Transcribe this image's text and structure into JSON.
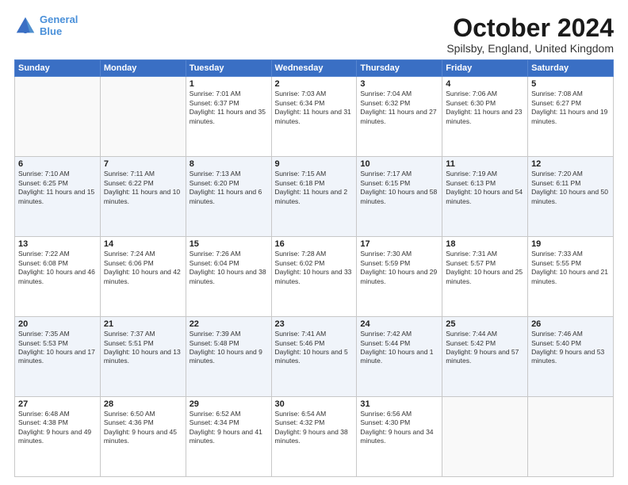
{
  "logo": {
    "line1": "General",
    "line2": "Blue"
  },
  "title": "October 2024",
  "subtitle": "Spilsby, England, United Kingdom",
  "days_of_week": [
    "Sunday",
    "Monday",
    "Tuesday",
    "Wednesday",
    "Thursday",
    "Friday",
    "Saturday"
  ],
  "weeks": [
    [
      {
        "day": "",
        "sunrise": "",
        "sunset": "",
        "daylight": ""
      },
      {
        "day": "",
        "sunrise": "",
        "sunset": "",
        "daylight": ""
      },
      {
        "day": "1",
        "sunrise": "Sunrise: 7:01 AM",
        "sunset": "Sunset: 6:37 PM",
        "daylight": "Daylight: 11 hours and 35 minutes."
      },
      {
        "day": "2",
        "sunrise": "Sunrise: 7:03 AM",
        "sunset": "Sunset: 6:34 PM",
        "daylight": "Daylight: 11 hours and 31 minutes."
      },
      {
        "day": "3",
        "sunrise": "Sunrise: 7:04 AM",
        "sunset": "Sunset: 6:32 PM",
        "daylight": "Daylight: 11 hours and 27 minutes."
      },
      {
        "day": "4",
        "sunrise": "Sunrise: 7:06 AM",
        "sunset": "Sunset: 6:30 PM",
        "daylight": "Daylight: 11 hours and 23 minutes."
      },
      {
        "day": "5",
        "sunrise": "Sunrise: 7:08 AM",
        "sunset": "Sunset: 6:27 PM",
        "daylight": "Daylight: 11 hours and 19 minutes."
      }
    ],
    [
      {
        "day": "6",
        "sunrise": "Sunrise: 7:10 AM",
        "sunset": "Sunset: 6:25 PM",
        "daylight": "Daylight: 11 hours and 15 minutes."
      },
      {
        "day": "7",
        "sunrise": "Sunrise: 7:11 AM",
        "sunset": "Sunset: 6:22 PM",
        "daylight": "Daylight: 11 hours and 10 minutes."
      },
      {
        "day": "8",
        "sunrise": "Sunrise: 7:13 AM",
        "sunset": "Sunset: 6:20 PM",
        "daylight": "Daylight: 11 hours and 6 minutes."
      },
      {
        "day": "9",
        "sunrise": "Sunrise: 7:15 AM",
        "sunset": "Sunset: 6:18 PM",
        "daylight": "Daylight: 11 hours and 2 minutes."
      },
      {
        "day": "10",
        "sunrise": "Sunrise: 7:17 AM",
        "sunset": "Sunset: 6:15 PM",
        "daylight": "Daylight: 10 hours and 58 minutes."
      },
      {
        "day": "11",
        "sunrise": "Sunrise: 7:19 AM",
        "sunset": "Sunset: 6:13 PM",
        "daylight": "Daylight: 10 hours and 54 minutes."
      },
      {
        "day": "12",
        "sunrise": "Sunrise: 7:20 AM",
        "sunset": "Sunset: 6:11 PM",
        "daylight": "Daylight: 10 hours and 50 minutes."
      }
    ],
    [
      {
        "day": "13",
        "sunrise": "Sunrise: 7:22 AM",
        "sunset": "Sunset: 6:08 PM",
        "daylight": "Daylight: 10 hours and 46 minutes."
      },
      {
        "day": "14",
        "sunrise": "Sunrise: 7:24 AM",
        "sunset": "Sunset: 6:06 PM",
        "daylight": "Daylight: 10 hours and 42 minutes."
      },
      {
        "day": "15",
        "sunrise": "Sunrise: 7:26 AM",
        "sunset": "Sunset: 6:04 PM",
        "daylight": "Daylight: 10 hours and 38 minutes."
      },
      {
        "day": "16",
        "sunrise": "Sunrise: 7:28 AM",
        "sunset": "Sunset: 6:02 PM",
        "daylight": "Daylight: 10 hours and 33 minutes."
      },
      {
        "day": "17",
        "sunrise": "Sunrise: 7:30 AM",
        "sunset": "Sunset: 5:59 PM",
        "daylight": "Daylight: 10 hours and 29 minutes."
      },
      {
        "day": "18",
        "sunrise": "Sunrise: 7:31 AM",
        "sunset": "Sunset: 5:57 PM",
        "daylight": "Daylight: 10 hours and 25 minutes."
      },
      {
        "day": "19",
        "sunrise": "Sunrise: 7:33 AM",
        "sunset": "Sunset: 5:55 PM",
        "daylight": "Daylight: 10 hours and 21 minutes."
      }
    ],
    [
      {
        "day": "20",
        "sunrise": "Sunrise: 7:35 AM",
        "sunset": "Sunset: 5:53 PM",
        "daylight": "Daylight: 10 hours and 17 minutes."
      },
      {
        "day": "21",
        "sunrise": "Sunrise: 7:37 AM",
        "sunset": "Sunset: 5:51 PM",
        "daylight": "Daylight: 10 hours and 13 minutes."
      },
      {
        "day": "22",
        "sunrise": "Sunrise: 7:39 AM",
        "sunset": "Sunset: 5:48 PM",
        "daylight": "Daylight: 10 hours and 9 minutes."
      },
      {
        "day": "23",
        "sunrise": "Sunrise: 7:41 AM",
        "sunset": "Sunset: 5:46 PM",
        "daylight": "Daylight: 10 hours and 5 minutes."
      },
      {
        "day": "24",
        "sunrise": "Sunrise: 7:42 AM",
        "sunset": "Sunset: 5:44 PM",
        "daylight": "Daylight: 10 hours and 1 minute."
      },
      {
        "day": "25",
        "sunrise": "Sunrise: 7:44 AM",
        "sunset": "Sunset: 5:42 PM",
        "daylight": "Daylight: 9 hours and 57 minutes."
      },
      {
        "day": "26",
        "sunrise": "Sunrise: 7:46 AM",
        "sunset": "Sunset: 5:40 PM",
        "daylight": "Daylight: 9 hours and 53 minutes."
      }
    ],
    [
      {
        "day": "27",
        "sunrise": "Sunrise: 6:48 AM",
        "sunset": "Sunset: 4:38 PM",
        "daylight": "Daylight: 9 hours and 49 minutes."
      },
      {
        "day": "28",
        "sunrise": "Sunrise: 6:50 AM",
        "sunset": "Sunset: 4:36 PM",
        "daylight": "Daylight: 9 hours and 45 minutes."
      },
      {
        "day": "29",
        "sunrise": "Sunrise: 6:52 AM",
        "sunset": "Sunset: 4:34 PM",
        "daylight": "Daylight: 9 hours and 41 minutes."
      },
      {
        "day": "30",
        "sunrise": "Sunrise: 6:54 AM",
        "sunset": "Sunset: 4:32 PM",
        "daylight": "Daylight: 9 hours and 38 minutes."
      },
      {
        "day": "31",
        "sunrise": "Sunrise: 6:56 AM",
        "sunset": "Sunset: 4:30 PM",
        "daylight": "Daylight: 9 hours and 34 minutes."
      },
      {
        "day": "",
        "sunrise": "",
        "sunset": "",
        "daylight": ""
      },
      {
        "day": "",
        "sunrise": "",
        "sunset": "",
        "daylight": ""
      }
    ]
  ]
}
